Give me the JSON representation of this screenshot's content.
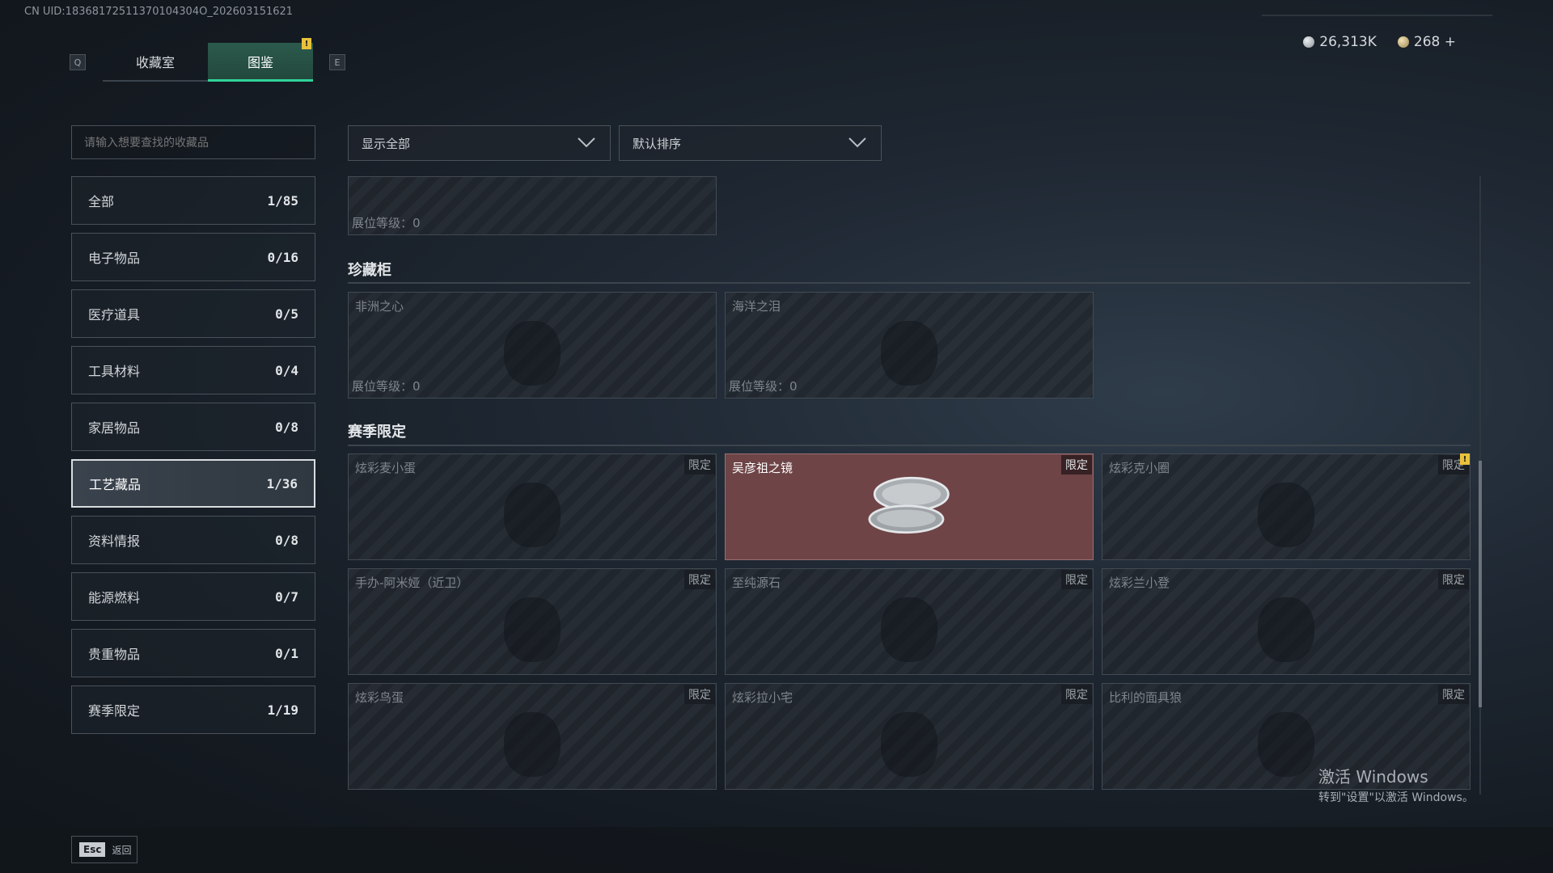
{
  "uid_text": "CN UID:18368172511370104304O_202603151621",
  "header": {
    "key_left": "Q",
    "key_right": "E",
    "tabs": [
      {
        "label": "收藏室",
        "active": false
      },
      {
        "label": "图鉴",
        "active": true,
        "alert": "!"
      }
    ],
    "currency": [
      {
        "icon": "silver-coin-icon",
        "value": "26,313K"
      },
      {
        "icon": "gold-coin-icon",
        "value": "268 +"
      }
    ]
  },
  "sidebar": {
    "search_placeholder": "请输入想要查找的收藏品",
    "categories": [
      {
        "label": "全部",
        "count": "1/85"
      },
      {
        "label": "电子物品",
        "count": "0/16"
      },
      {
        "label": "医疗道具",
        "count": "0/5"
      },
      {
        "label": "工具材料",
        "count": "0/4"
      },
      {
        "label": "家居物品",
        "count": "0/8"
      },
      {
        "label": "工艺藏品",
        "count": "1/36",
        "active": true
      },
      {
        "label": "资料情报",
        "count": "0/8"
      },
      {
        "label": "能源燃料",
        "count": "0/7"
      },
      {
        "label": "贵重物品",
        "count": "0/1"
      },
      {
        "label": "赛季限定",
        "count": "1/19"
      }
    ]
  },
  "filters": {
    "display": "显示全部",
    "sort": "默认排序"
  },
  "top_partial": {
    "level": "展位等级：0"
  },
  "sections": [
    {
      "title": "珍藏柜",
      "items": [
        {
          "name": "非洲之心",
          "level": "展位等级：0"
        },
        {
          "name": "海洋之泪",
          "level": "展位等级：0"
        }
      ]
    },
    {
      "title": "赛季限定",
      "items": [
        {
          "name": "炫彩麦小蛋",
          "tag": "限定"
        },
        {
          "name": "吴彦祖之镜",
          "tag": "限定",
          "selected": true
        },
        {
          "name": "炫彩克小圈",
          "tag": "限定",
          "alert": "!"
        },
        {
          "name": "手办-阿米娅（近卫）",
          "tag": "限定"
        },
        {
          "name": "至纯源石",
          "tag": "限定"
        },
        {
          "name": "炫彩兰小登",
          "tag": "限定"
        },
        {
          "name": "炫彩鸟蛋",
          "tag": "限定"
        },
        {
          "name": "炫彩拉小宅",
          "tag": "限定"
        },
        {
          "name": "比利的面具狼",
          "tag": "限定"
        }
      ]
    }
  ],
  "watermark": {
    "line1": "激活 Windows",
    "line2": "转到\"设置\"以激活 Windows。"
  },
  "footer": {
    "key": "Esc",
    "label": "返回"
  }
}
